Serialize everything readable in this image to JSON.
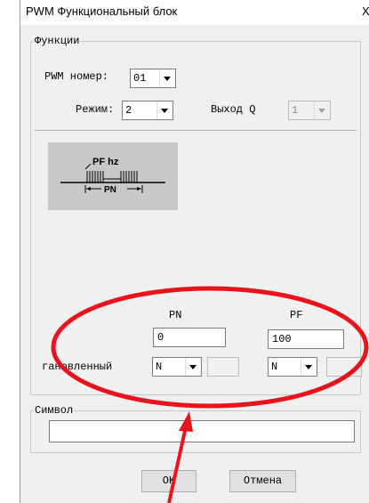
{
  "window": {
    "title": "PWM Функциональный блок",
    "close_glyph": "X"
  },
  "functions_group": {
    "label": "Функции",
    "pwm_number": {
      "label": "PWM номер:",
      "value": "01"
    },
    "mode": {
      "label": "Режим:",
      "value": "2"
    },
    "output_q": {
      "label": "Выход Q",
      "value": "1"
    }
  },
  "diagram": {
    "pf_label": "PF hz",
    "pn_label": "PN"
  },
  "params": {
    "pn_header": "PN",
    "pf_header": "PF",
    "pn_value": "0",
    "pf_value": "100",
    "row_label": "гановленный",
    "pn_unit": "N",
    "pf_unit": "N"
  },
  "symbol_group": {
    "label": "Символ",
    "value": ""
  },
  "buttons": {
    "ok": "OK",
    "cancel": "Отмена"
  },
  "annotation": {
    "color": "#e8141b"
  }
}
